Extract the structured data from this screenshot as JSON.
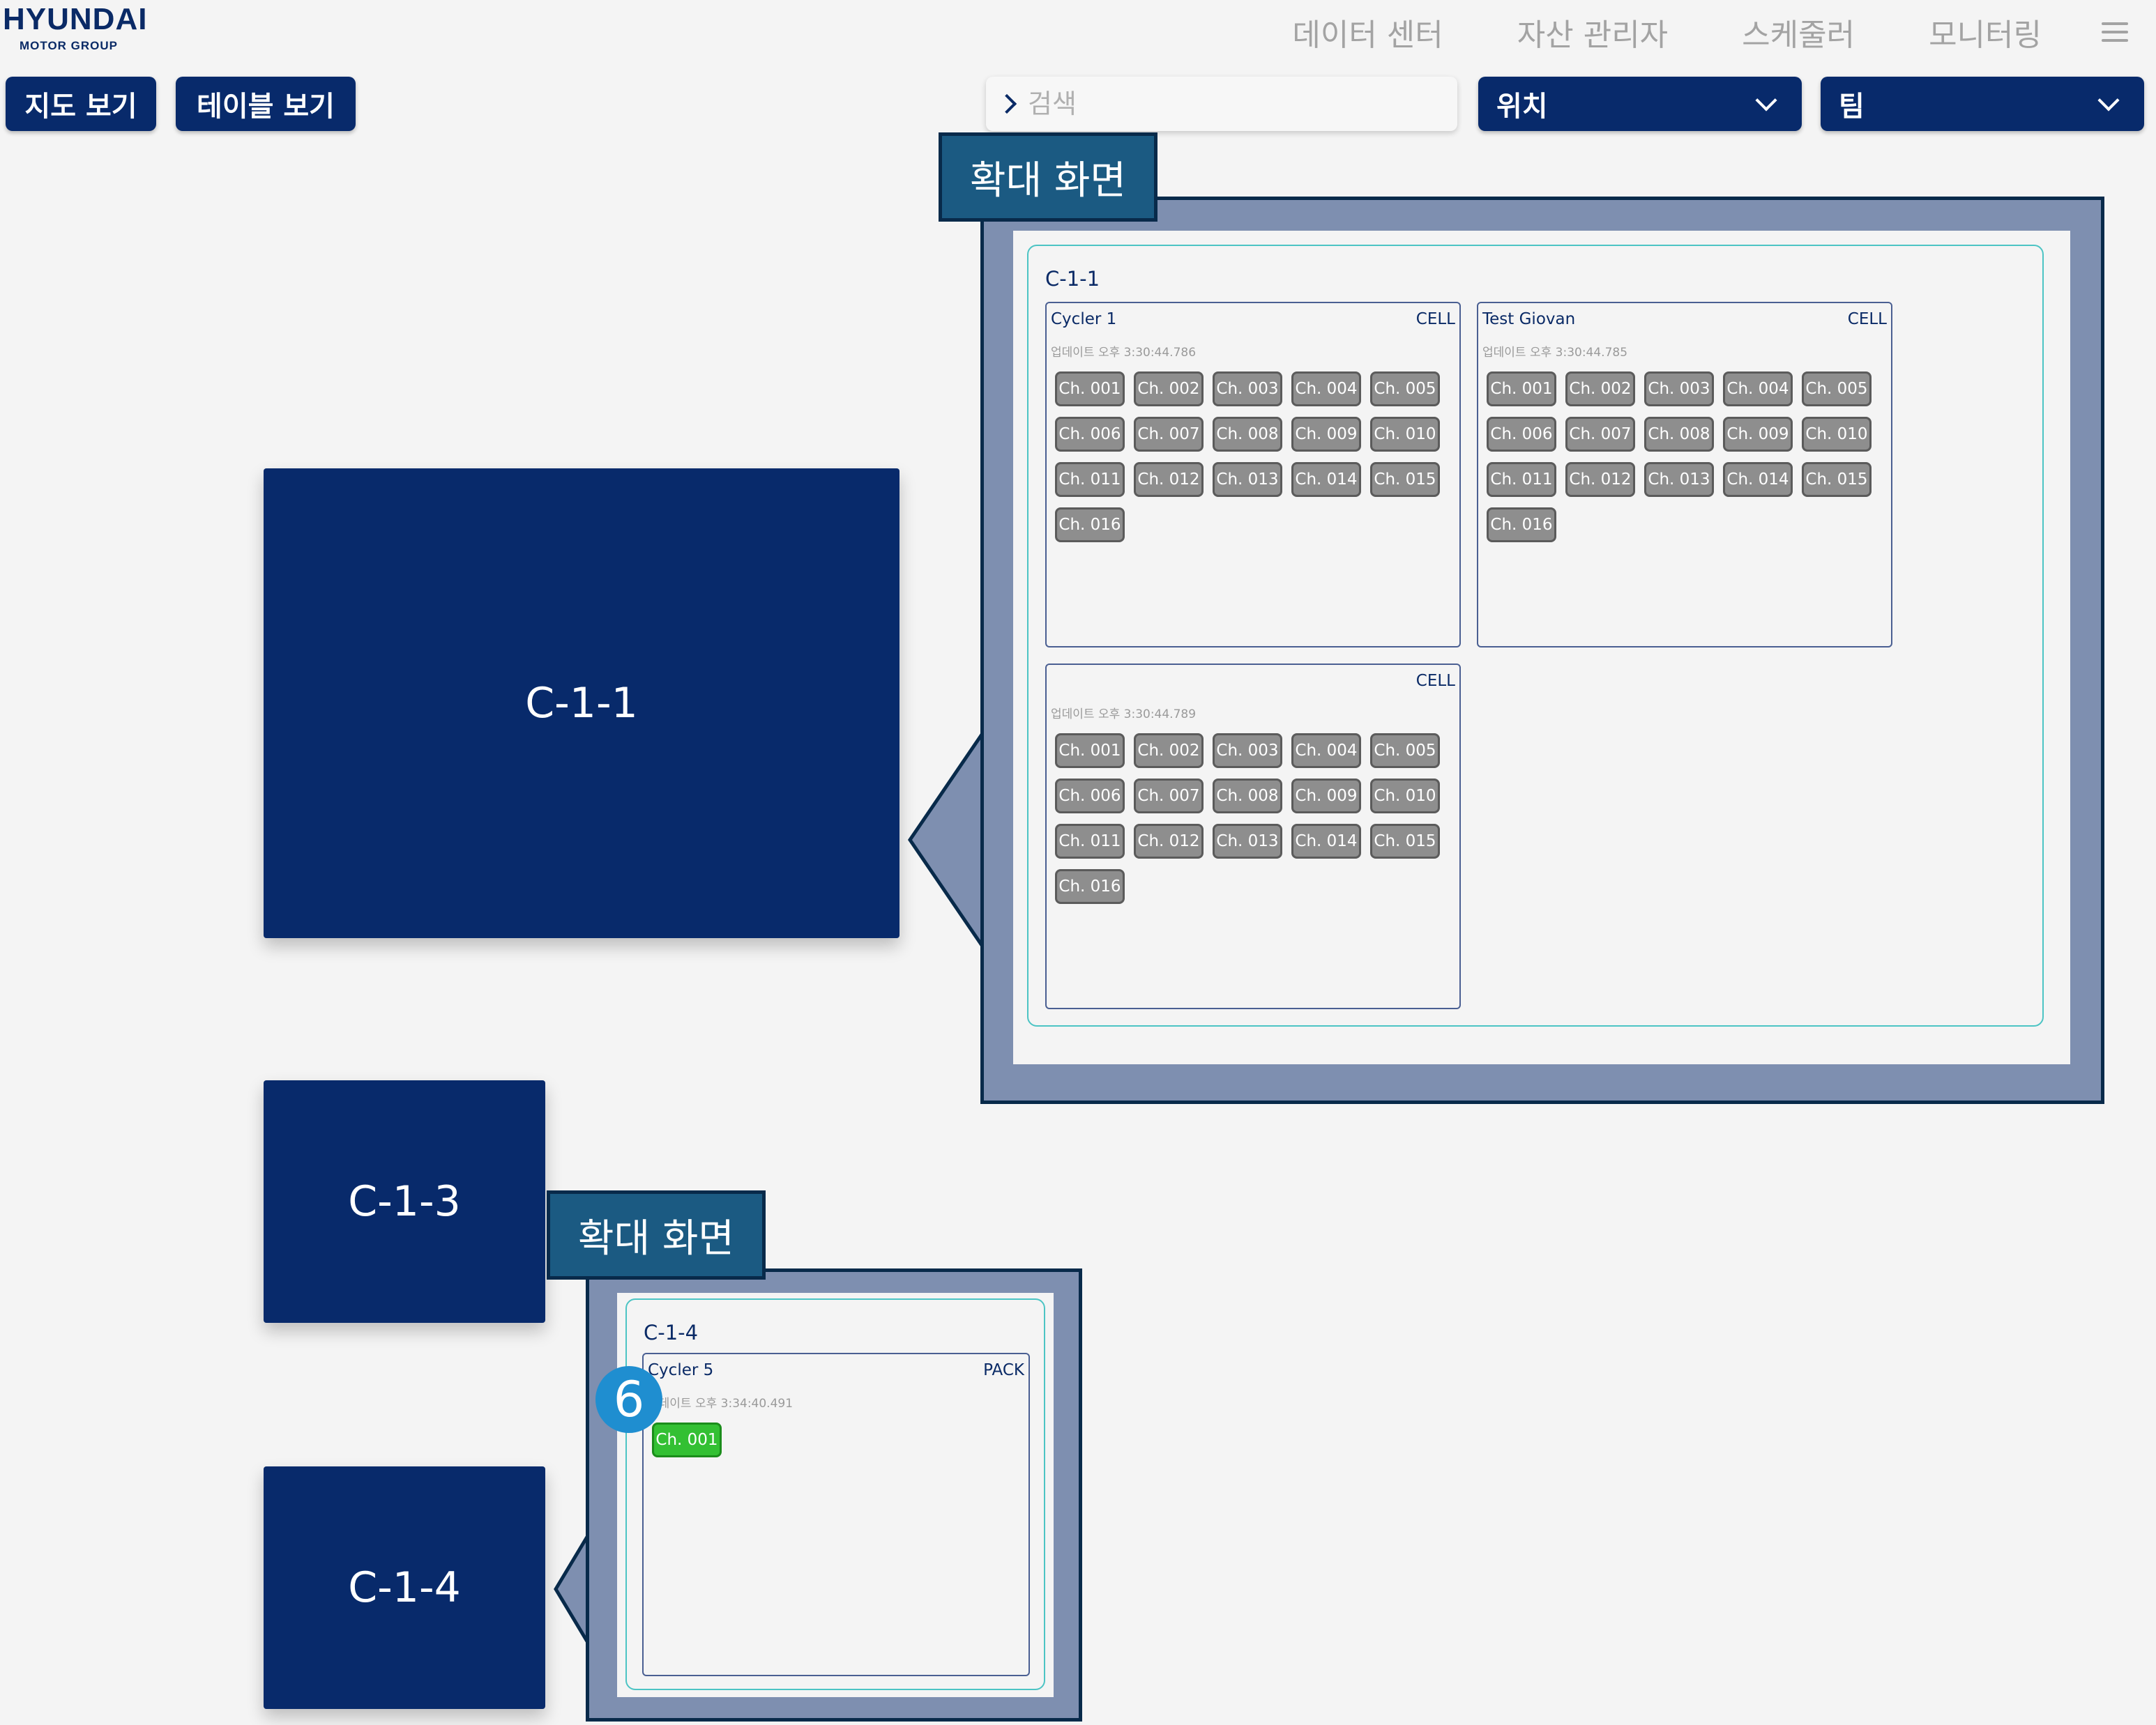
{
  "header": {
    "logo": {
      "brand": "HYUNDAI",
      "sub": "MOTOR GROUP"
    },
    "nav": [
      "데이터 센터",
      "자산 관리자",
      "스케줄러",
      "모니터링"
    ],
    "menu_icon": "hamburger-menu-icon"
  },
  "toolbar": {
    "map_view_label": "지도 보기",
    "table_view_label": "테이블 보기",
    "search": {
      "placeholder": "검색",
      "value": ""
    },
    "location_select": "위치",
    "team_select": "팀"
  },
  "colors": {
    "primary": "#082a6b",
    "zoom_frame": "#7e8fb0",
    "zoom_tag": "#1b5a82",
    "room_border": "#4cc4c4",
    "channel_idle": "#8e8e8e",
    "channel_active": "#33c033",
    "badge": "#1f8ed0"
  },
  "map": {
    "blocks": [
      {
        "id": "C-1-1",
        "label": "C-1-1"
      },
      {
        "id": "C-1-3",
        "label": "C-1-3"
      },
      {
        "id": "C-1-4",
        "label": "C-1-4"
      }
    ]
  },
  "zoom_panels": [
    {
      "tag": "확대 화면",
      "room": "C-1-1",
      "cyclers": [
        {
          "name": "Cycler 1",
          "type": "CELL",
          "updated": "업데이트 오후 3:30:44.786",
          "channels": [
            "Ch. 001",
            "Ch. 002",
            "Ch. 003",
            "Ch. 004",
            "Ch. 005",
            "Ch. 006",
            "Ch. 007",
            "Ch. 008",
            "Ch. 009",
            "Ch. 010",
            "Ch. 011",
            "Ch. 012",
            "Ch. 013",
            "Ch. 014",
            "Ch. 015",
            "Ch. 016"
          ]
        },
        {
          "name": "Test Giovan",
          "type": "CELL",
          "updated": "업데이트 오후 3:30:44.785",
          "channels": [
            "Ch. 001",
            "Ch. 002",
            "Ch. 003",
            "Ch. 004",
            "Ch. 005",
            "Ch. 006",
            "Ch. 007",
            "Ch. 008",
            "Ch. 009",
            "Ch. 010",
            "Ch. 011",
            "Ch. 012",
            "Ch. 013",
            "Ch. 014",
            "Ch. 015",
            "Ch. 016"
          ]
        },
        {
          "name": "",
          "type": "CELL",
          "updated": "업데이트 오후 3:30:44.789",
          "channels": [
            "Ch. 001",
            "Ch. 002",
            "Ch. 003",
            "Ch. 004",
            "Ch. 005",
            "Ch. 006",
            "Ch. 007",
            "Ch. 008",
            "Ch. 009",
            "Ch. 010",
            "Ch. 011",
            "Ch. 012",
            "Ch. 013",
            "Ch. 014",
            "Ch. 015",
            "Ch. 016"
          ]
        }
      ]
    },
    {
      "tag": "확대 화면",
      "room": "C-1-4",
      "badge": "6",
      "cyclers": [
        {
          "name": "Cycler 5",
          "type": "PACK",
          "updated": "업데이트 오후 3:34:40.491",
          "channels": [
            "Ch. 001"
          ],
          "active_channel": "Ch. 001"
        }
      ]
    }
  ]
}
